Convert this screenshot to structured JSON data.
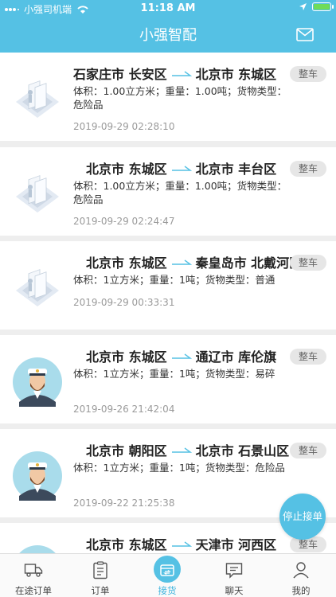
{
  "status_bar": {
    "carrier": "小强司机端",
    "time": "11:18 AM"
  },
  "header": {
    "title": "小强智配",
    "mail_icon": "mail-icon"
  },
  "orders": [
    {
      "from": "石家庄市 长安区",
      "to": "北京市 东城区",
      "type": "整车",
      "desc": "体积：1.00立方米；重量：1.00吨；货物类型：危险品",
      "time": "2019-09-29 02:28:10",
      "avatar": "cargo-illustration"
    },
    {
      "from": "北京市 东城区",
      "to": "北京市 丰台区",
      "type": "整车",
      "desc": "体积：1.00立方米；重量：1.00吨；货物类型：危险品",
      "time": "2019-09-29 02:24:47",
      "avatar": "cargo-illustration"
    },
    {
      "from": "北京市 东城区",
      "to": "秦皇岛市 北戴河区",
      "type": "整车",
      "desc": "体积：1立方米；重量：1吨；货物类型：普通",
      "time": "2019-09-29 00:33:31",
      "avatar": "cargo-illustration"
    },
    {
      "from": "北京市 东城区",
      "to": "通辽市 库伦旗",
      "type": "整车",
      "desc": "体积：1立方米；重量：1吨；货物类型：易碎",
      "time": "2019-09-26 21:42:04",
      "avatar": "captain-avatar"
    },
    {
      "from": "北京市 朝阳区",
      "to": "北京市 石景山区",
      "type": "整车",
      "desc": "体积：1立方米；重量：1吨；货物类型：危险品",
      "time": "2019-09-22 21:25:38",
      "avatar": "captain-avatar"
    },
    {
      "from": "北京市 东城区",
      "to": "天津市 河西区",
      "type": "整车",
      "desc": "",
      "time": "",
      "avatar": "captain-avatar"
    }
  ],
  "fab": {
    "label": "停止接单"
  },
  "tabs": [
    {
      "label": "在途订单",
      "icon": "truck-icon"
    },
    {
      "label": "订单",
      "icon": "clipboard-icon"
    },
    {
      "label": "接货",
      "icon": "receive-icon",
      "active": true
    },
    {
      "label": "聊天",
      "icon": "chat-icon"
    },
    {
      "label": "我的",
      "icon": "profile-icon"
    }
  ],
  "colors": {
    "primary": "#55c1e4",
    "badge_bg": "#e6e6e6",
    "timestamp": "#9a9a9a"
  }
}
